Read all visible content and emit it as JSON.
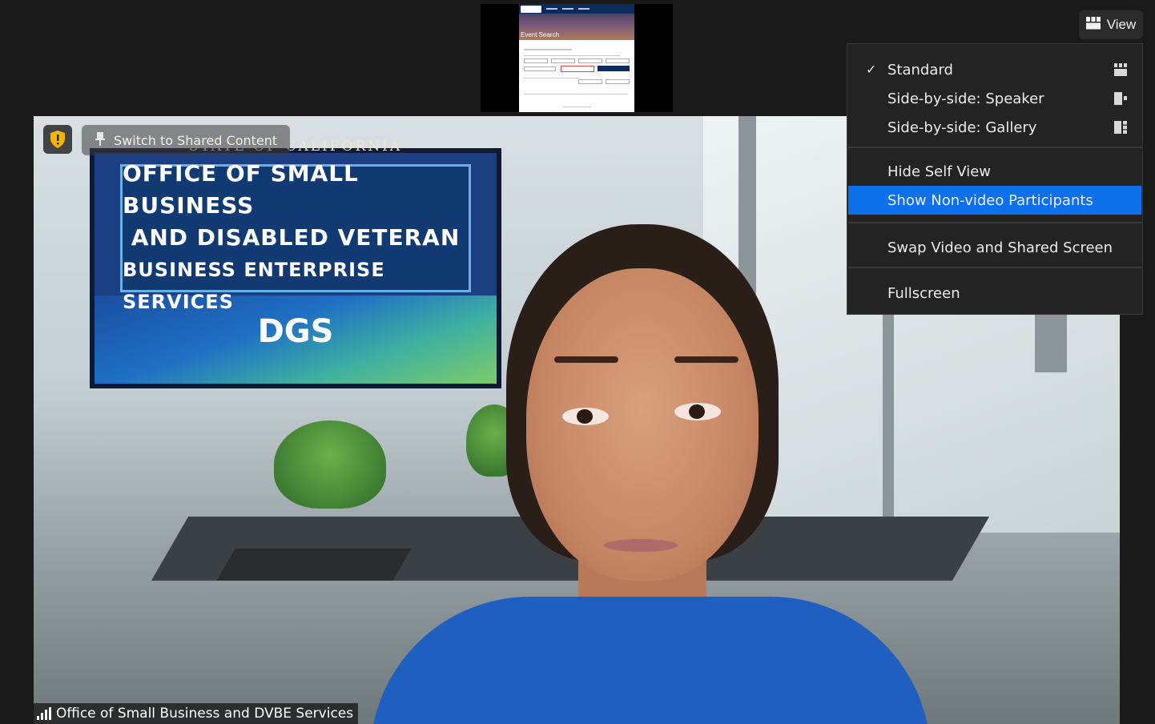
{
  "shared_screen": {
    "page_title": "Event Search"
  },
  "overlays": {
    "switch_label": "Switch to Shared Content",
    "participant_name": "Office of Small Business and DVBE Services"
  },
  "sign": {
    "state": "STATE OF CALIFORNIA",
    "line1": "OFFICE OF SMALL BUSINESS",
    "line2": "AND DISABLED VETERAN",
    "line3": "BUSINESS ENTERPRISE SERVICES",
    "logo": "DGS"
  },
  "view_button": {
    "label": "View",
    "icon": "gallery-grid-icon"
  },
  "view_menu": {
    "items": [
      {
        "label": "Standard",
        "checked": true,
        "icon": "standard-layout-icon"
      },
      {
        "label": "Side-by-side: Speaker",
        "icon": "side-speaker-icon"
      },
      {
        "label": "Side-by-side: Gallery",
        "icon": "side-gallery-icon"
      },
      {
        "label": "Hide Self View"
      },
      {
        "label": "Show Non-video Participants",
        "highlighted": true
      },
      {
        "label": "Swap Video and Shared Screen"
      },
      {
        "label": "Fullscreen"
      }
    ]
  },
  "colors": {
    "menu_bg": "#232323",
    "highlight": "#0e71eb",
    "app_bg": "#1a1a1a"
  }
}
